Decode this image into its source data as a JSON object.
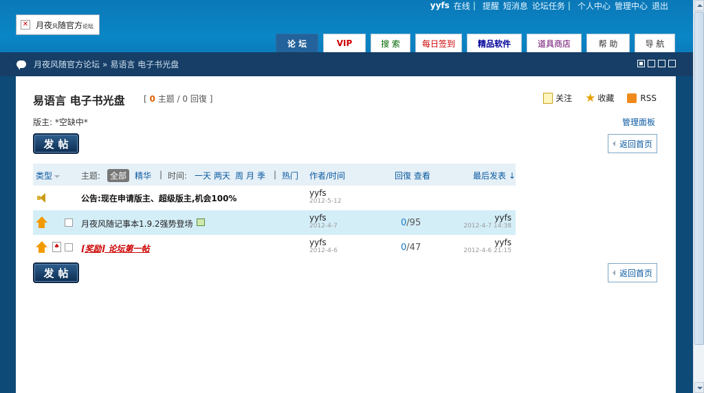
{
  "site": {
    "logo_text": "月夜",
    "logo_text_small": "风",
    "logo_text_2": "随官方",
    "logo_text_small_2": "论坛"
  },
  "toplinks": {
    "user": "yyfs",
    "status": "在线",
    "items": [
      "提醒",
      "短消息",
      "论坛任务",
      "个人中心",
      "管理中心",
      "退出"
    ]
  },
  "nav": {
    "tabs": [
      {
        "label": "论 坛",
        "color": "#ffffff"
      },
      {
        "label": "VIP",
        "color": "#cc0000"
      },
      {
        "label": "搜 索",
        "color": "#006600"
      },
      {
        "label": "每日签到",
        "color": "#cc0000"
      },
      {
        "label": "精品软件",
        "color": "#000099"
      },
      {
        "label": "道具商店",
        "color": "#660066"
      },
      {
        "label": "帮 助",
        "color": "#333333"
      },
      {
        "label": "导 航",
        "color": "#333333"
      }
    ]
  },
  "breadcrumb": {
    "home": "月夜风随官方论坛",
    "sep": "»",
    "current": "易语言 电子书光盘"
  },
  "forum": {
    "title": "易语言 电子书光盘",
    "count_open": "[",
    "topics": "0",
    "topics_label": "主题 /",
    "replies": "0",
    "replies_label": "回復",
    "count_close": "]",
    "follow": "关注",
    "favorite": "收藏",
    "rss": "RSS",
    "moderator": "版主: *空缺中*",
    "admin_panel": "管理面板",
    "post_button": "发帖",
    "back_button": "返回首页"
  },
  "list_header": {
    "type": "类型",
    "topic_label": "主题:",
    "all": "全部",
    "digest": "精华",
    "sep": "|",
    "time_label": "时间:",
    "times": [
      "一天",
      "两天",
      "周",
      "月",
      "季"
    ],
    "hot": "热门",
    "author": "作者/时间",
    "replies_views": "回復 查看",
    "last_post": "最后发表 ↓"
  },
  "threads": [
    {
      "kind": "announcement",
      "prefix": "公告:",
      "title": "现在申请版主、超级版主,机会100%",
      "author": "yyfs",
      "date": "2012-5-12"
    },
    {
      "kind": "normal",
      "title": "月夜风随记事本1.9.2强势登场",
      "author": "yyfs",
      "date": "2012-4-7",
      "replies": "0",
      "views": "95",
      "last_user": "yyfs",
      "last_time": "2012-4-7 14:38"
    },
    {
      "kind": "reward",
      "title": "[奖励] 论坛第一帖",
      "author": "yyfs",
      "date": "2012-4-6",
      "replies": "0",
      "views": "47",
      "last_user": "yyfs",
      "last_time": "2012-4-6 21:15"
    }
  ],
  "colors": {
    "header_bg": "#0a86c6",
    "crumb_bg": "#163e66",
    "accent_link": "#0b5aa0",
    "highlight_row": "#d4eef8",
    "reward_title": "#cc0000"
  }
}
